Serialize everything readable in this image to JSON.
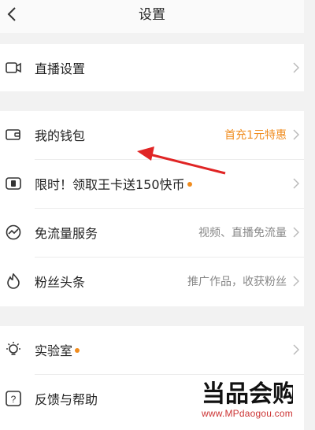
{
  "header": {
    "title": "设置"
  },
  "groups": [
    {
      "rows": [
        {
          "icon": "live-camera-icon",
          "label": "直播设置",
          "value": ""
        }
      ]
    },
    {
      "rows": [
        {
          "icon": "wallet-icon",
          "label": "我的钱包",
          "value": "首充1元特惠",
          "value_color": "#f08c1e"
        },
        {
          "icon": "sim-card-icon",
          "label": "限时！领取王卡送150快币",
          "dot": true,
          "value": ""
        },
        {
          "icon": "data-wave-icon",
          "label": "免流量服务",
          "value": "视频、直播免流量"
        },
        {
          "icon": "flame-icon",
          "label": "粉丝头条",
          "value": "推广作品，收获粉丝"
        }
      ]
    },
    {
      "rows": [
        {
          "icon": "lightbulb-icon",
          "label": "实验室",
          "dot": true,
          "value": ""
        },
        {
          "icon": "help-icon",
          "label": "反馈与帮助",
          "value": ""
        }
      ]
    }
  ],
  "watermark": {
    "brand": "当品会购",
    "url": "www.MPdaogou.com"
  },
  "colors": {
    "accent": "#f08c1e",
    "annotation_arrow": "#e02424"
  }
}
